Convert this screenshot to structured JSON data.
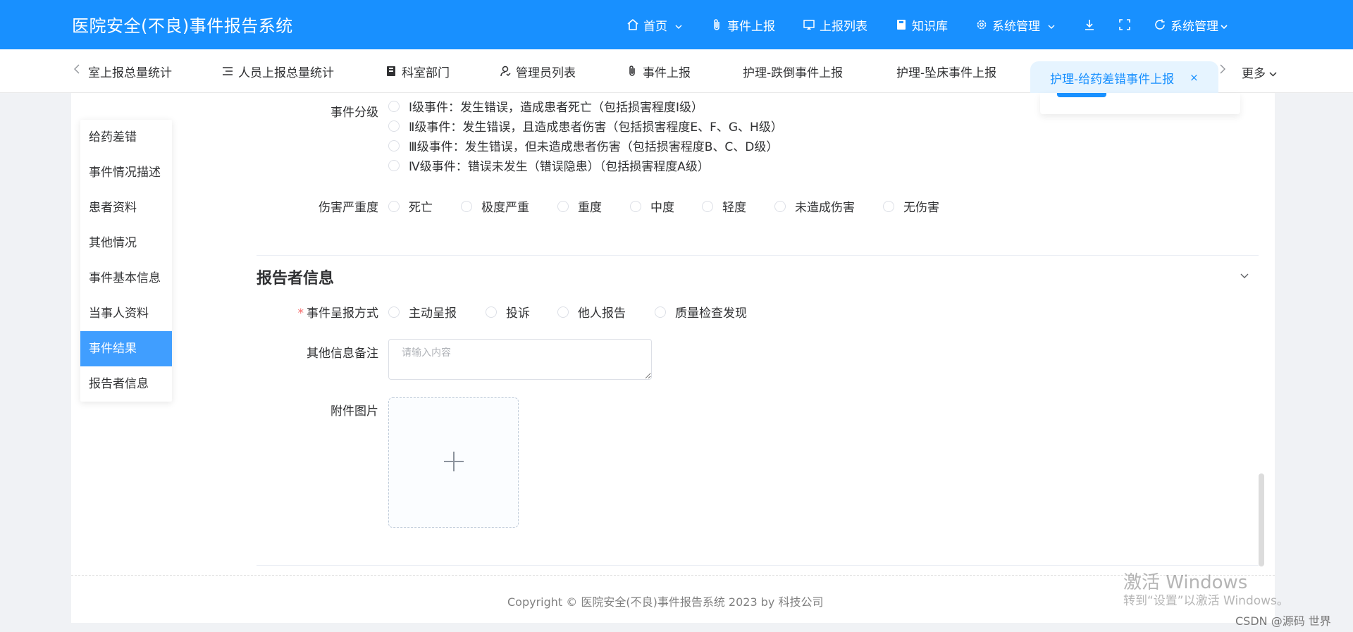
{
  "header": {
    "app_title": "医院安全(不良)事件报告系统",
    "nav": [
      {
        "label": "首页",
        "icon": "home-icon",
        "has_dropdown": true
      },
      {
        "label": "事件上报",
        "icon": "paperclip-icon",
        "has_dropdown": false
      },
      {
        "label": "上报列表",
        "icon": "monitor-icon",
        "has_dropdown": false
      },
      {
        "label": "知识库",
        "icon": "book-icon",
        "has_dropdown": false
      },
      {
        "label": "系统管理",
        "icon": "gear-icon",
        "has_dropdown": true
      }
    ],
    "tools": [
      "download-icon",
      "fullscreen-icon"
    ],
    "user_menu": {
      "label": "系统管理",
      "icon": "refresh-icon"
    },
    "brand_color": "#1890ff"
  },
  "tabs": {
    "items": [
      {
        "label": "室上报总量统计",
        "icon": ""
      },
      {
        "label": "人员上报总量统计",
        "icon": "list-icon"
      },
      {
        "label": "科室部门",
        "icon": "book-icon"
      },
      {
        "label": "管理员列表",
        "icon": "user-icon"
      },
      {
        "label": "事件上报",
        "icon": "paperclip-icon"
      },
      {
        "label": "护理-跌倒事件上报",
        "icon": ""
      },
      {
        "label": "护理-坠床事件上报",
        "icon": ""
      }
    ],
    "active": {
      "label": "护理-给药差错事件上报",
      "close": "×"
    },
    "more_label": "更多"
  },
  "anchor_menu": {
    "items": [
      "给药差错",
      "事件情况描述",
      "患者资料",
      "其他情况",
      "事件基本信息",
      "当事人资料",
      "事件结果",
      "报告者信息"
    ],
    "active_index": 6
  },
  "form": {
    "event_grade": {
      "label": "事件分级",
      "options": [
        "Ⅰ级事件：发生错误，造成患者死亡（包括损害程度Ⅰ级）",
        "Ⅱ级事件：发生错误，且造成患者伤害（包括损害程度E、F、G、H级）",
        "Ⅲ级事件：发生错误，但未造成患者伤害（包括损害程度B、C、D级）",
        "Ⅳ级事件：错误未发生（错误隐患）（包括损害程度A级）"
      ]
    },
    "harm_severity": {
      "label": "伤害严重度",
      "options": [
        "死亡",
        "极度严重",
        "重度",
        "中度",
        "轻度",
        "未造成伤害",
        "无伤害"
      ]
    },
    "reporter_section": {
      "title": "报告者信息",
      "report_method": {
        "label": "事件呈报方式",
        "required_mark": "*",
        "options": [
          "主动呈报",
          "投诉",
          "他人报告",
          "质量检查发现"
        ]
      },
      "remark": {
        "label": "其他信息备注",
        "placeholder": "请输入内容",
        "value": ""
      },
      "attachment": {
        "label": "附件图片"
      }
    }
  },
  "footer": {
    "text": "Copyright © 医院安全(不良)事件报告系统 2023 by 科技公司"
  },
  "overlay": {
    "activation_title": "激活 Windows",
    "activation_sub": "转到“设置”以激活 Windows。",
    "csdn_mark": "CSDN @源码 世界"
  }
}
